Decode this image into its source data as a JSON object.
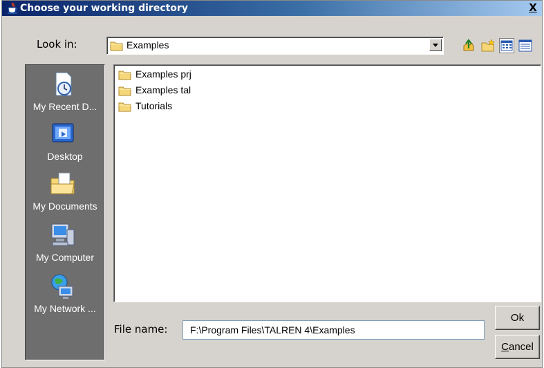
{
  "window": {
    "title": "Choose your working directory",
    "close_label": "X",
    "title_icon": "java-cup-icon"
  },
  "look_in": {
    "label": "Look in:",
    "value": "Examples",
    "icon": "folder-icon"
  },
  "toolbar": [
    {
      "icon": "up-one-level-icon"
    },
    {
      "icon": "new-folder-icon"
    },
    {
      "icon": "list-view-icon",
      "pressed": true
    },
    {
      "icon": "details-view-icon"
    }
  ],
  "places": [
    {
      "label": "My Recent D...",
      "icon": "recent-documents-icon"
    },
    {
      "label": "Desktop",
      "icon": "desktop-icon"
    },
    {
      "label": "My Documents",
      "icon": "my-documents-icon"
    },
    {
      "label": "My Computer",
      "icon": "my-computer-icon"
    },
    {
      "label": "My Network ...",
      "icon": "network-places-icon"
    }
  ],
  "files": [
    {
      "name": "Examples prj",
      "icon": "folder-icon"
    },
    {
      "name": "Examples tal",
      "icon": "folder-icon"
    },
    {
      "name": "Tutorials",
      "icon": "folder-icon"
    }
  ],
  "file_name": {
    "label": "File name:",
    "value": "F:\\Program Files\\TALREN 4\\Examples"
  },
  "buttons": {
    "ok": "Ok",
    "cancel_first": "C",
    "cancel_rest": "ancel"
  },
  "colors": {
    "title_start": "#0a246a",
    "title_end": "#a6caf0",
    "window_bg": "#d6d3ce",
    "places_bg": "#6e6e6e"
  }
}
